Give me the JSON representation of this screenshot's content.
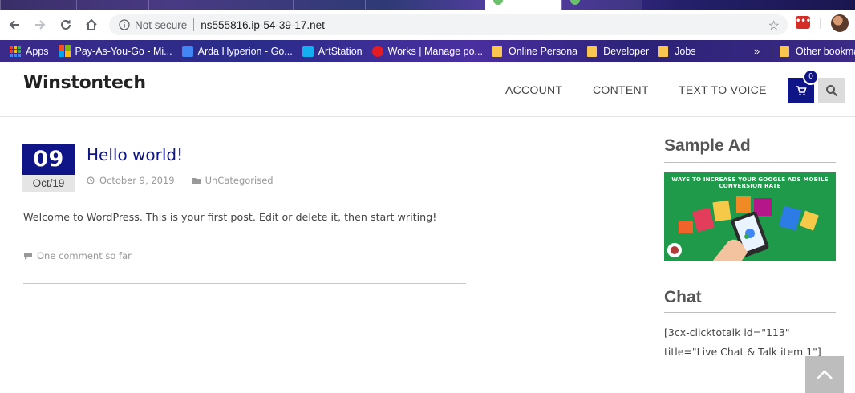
{
  "browser": {
    "security_label": "Not secure",
    "url": "ns555816.ip-54-39-17.net",
    "bookmarks": [
      {
        "label": "Apps",
        "icon": "apps-grid-icon"
      },
      {
        "label": "Pay-As-You-Go - Mi...",
        "icon": "microsoft-icon"
      },
      {
        "label": "Arda Hyperion - Go...",
        "icon": "google-docs-icon"
      },
      {
        "label": "ArtStation",
        "icon": "artstation-icon"
      },
      {
        "label": "Works | Manage po...",
        "icon": "works-icon"
      },
      {
        "label": "Online Persona",
        "icon": "folder-icon"
      },
      {
        "label": "Developer",
        "icon": "folder-icon"
      },
      {
        "label": "Jobs",
        "icon": "folder-icon"
      }
    ],
    "more_label": "»",
    "other_bookmarks": "Other bookma"
  },
  "site": {
    "title": "Winstontech",
    "nav": [
      "ACCOUNT",
      "CONTENT",
      "TEXT TO VOICE"
    ],
    "cart_count": "0"
  },
  "post": {
    "day": "09",
    "month": "Oct/19",
    "title": "Hello world!",
    "date": "October 9, 2019",
    "category": "UnCategorised",
    "excerpt": "Welcome to WordPress. This is your first post. Edit or delete it, then start writing!",
    "comments": "One comment so far"
  },
  "sidebar": {
    "ad_title": "Sample Ad",
    "ad_image_text": "WAYS TO INCREASE YOUR GOOGLE ADS MOBILE CONVERSION RATE",
    "chat_title": "Chat",
    "chat_text": "[3cx-clicktotalk id=\"113\" title=\"Live Chat & Talk item 1\"]"
  },
  "colors": {
    "brand": "#0f1486",
    "bookmark_bar": "#3b2a8a"
  }
}
